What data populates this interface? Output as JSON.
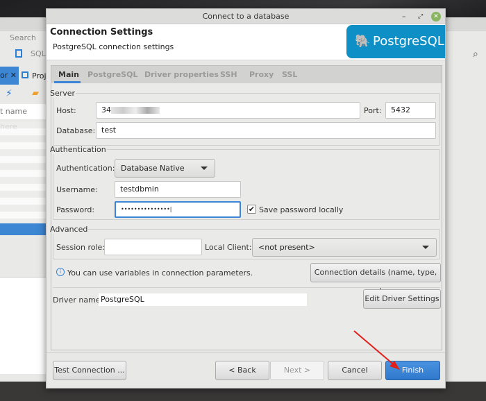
{
  "background_app": {
    "menu_search": "Search",
    "menu_s": "S",
    "toolbar_sql": "SQL",
    "tab_partial": "or",
    "tab_projects": "Proj",
    "filter_placeholder": "t name here"
  },
  "dialog": {
    "title": "Connect to a database",
    "header_title": "Connection Settings",
    "header_subtitle": "PostgreSQL connection settings",
    "logo_text": "PostgreSQL",
    "tabs": [
      {
        "label": "Main",
        "active": true
      },
      {
        "label": "PostgreSQL"
      },
      {
        "label": "Driver properties"
      },
      {
        "label": "SSH"
      },
      {
        "label": "Proxy"
      },
      {
        "label": "SSL"
      }
    ],
    "server": {
      "legend": "Server",
      "host_label": "Host:",
      "host_value": "34",
      "port_label": "Port:",
      "port_value": "5432",
      "database_label": "Database:",
      "database_value": "test"
    },
    "auth": {
      "legend": "Authentication",
      "auth_label": "Authentication:",
      "auth_value": "Database Native",
      "username_label": "Username:",
      "username_value": "testdbmin",
      "password_label": "Password:",
      "password_value": "•••••••••••••••",
      "save_password_label": "Save password locally",
      "save_password_checked": true
    },
    "advanced": {
      "legend": "Advanced",
      "session_role_label": "Session role:",
      "session_role_value": "",
      "local_client_label": "Local Client:",
      "local_client_value": "<not present>"
    },
    "info_text": "You can use variables in connection parameters.",
    "connection_details_button": "Connection details (name, type, ... )",
    "driver_name_label": "Driver name:",
    "driver_name_value": "PostgreSQL",
    "edit_driver_button": "Edit Driver Settings",
    "buttons": {
      "test": "Test Connection ...",
      "back": "< Back",
      "next": "Next >",
      "cancel": "Cancel",
      "finish": "Finish"
    },
    "colors": {
      "accent": "#3a85d6",
      "logo": "#0e90c6",
      "annotation_arrow": "#e0201b"
    }
  }
}
